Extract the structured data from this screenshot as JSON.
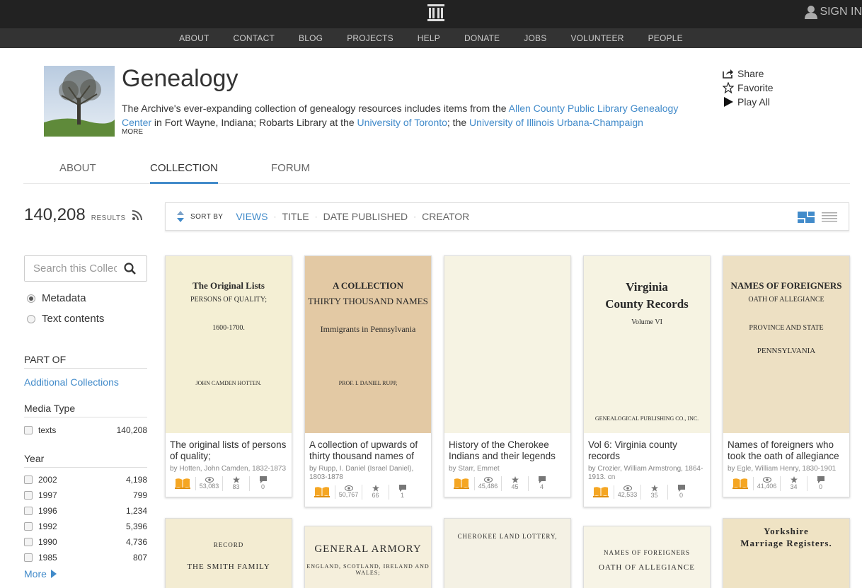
{
  "topbar": {
    "signin": "SIGN IN"
  },
  "nav": [
    "ABOUT",
    "CONTACT",
    "BLOG",
    "PROJECTS",
    "HELP",
    "DONATE",
    "JOBS",
    "VOLUNTEER",
    "PEOPLE"
  ],
  "header": {
    "title": "Genealogy",
    "desc_pre": "The Archive's ever-expanding collection of genealogy resources includes items from the ",
    "link1": "Allen County Public Library Genealogy Center",
    "desc_mid1": " in Fort Wayne, Indiana; Robarts Library at the ",
    "link2": "University of Toronto",
    "desc_mid2": "; the ",
    "link3": "University of Illinois Urbana-Champaign",
    "more": "MORE"
  },
  "actions": {
    "share": "Share",
    "favorite": "Favorite",
    "play_all": "Play All"
  },
  "tabs": [
    "ABOUT",
    "COLLECTION",
    "FORUM"
  ],
  "sidebar": {
    "results_count": "140,208",
    "results_label": "RESULTS",
    "search_placeholder": "Search this Collection",
    "radio_metadata": "Metadata",
    "radio_text": "Text contents",
    "part_of_heading": "PART OF",
    "part_of_link": "Additional Collections",
    "media_type_heading": "Media Type",
    "media_types": [
      {
        "name": "texts",
        "count": "140,208"
      }
    ],
    "year_heading": "Year",
    "years": [
      {
        "name": "2002",
        "count": "4,198"
      },
      {
        "name": "1997",
        "count": "799"
      },
      {
        "name": "1996",
        "count": "1,234"
      },
      {
        "name": "1992",
        "count": "5,396"
      },
      {
        "name": "1990",
        "count": "4,736"
      },
      {
        "name": "1985",
        "count": "807"
      }
    ],
    "more": "More"
  },
  "sortbar": {
    "label": "SORT BY",
    "options": [
      "VIEWS",
      "TITLE",
      "DATE PUBLISHED",
      "CREATOR"
    ]
  },
  "cards": [
    {
      "title": "The original lists of persons of quality;",
      "by": "by Hotten, John Camden, 1832-1873",
      "views": "53,083",
      "favs": "83",
      "reviews": "0",
      "cover": {
        "line1": "The Original Lists",
        "line2": "PERSONS OF QUALITY;",
        "line3": "1600-1700.",
        "line4": "JOHN CAMDEN HOTTEN."
      }
    },
    {
      "title": "A collection of upwards of thirty thousand names of",
      "by": "by Rupp, I. Daniel (Israel Daniel), 1803-1878",
      "views": "50,767",
      "favs": "66",
      "reviews": "1",
      "cover": {
        "line1": "A COLLECTION",
        "line2": "THIRTY THOUSAND NAMES",
        "line3": "Immigrants in Pennsylvania",
        "line4": "PROF. I. DANIEL RUPP,"
      }
    },
    {
      "title": "History of the Cherokee Indians and their legends",
      "by": "by Starr, Emmet",
      "views": "45,486",
      "favs": "45",
      "reviews": "4",
      "cover": {
        "line1": "",
        "line2": "",
        "line3": "",
        "line4": ""
      }
    },
    {
      "title": "Vol 6: Virginia county records",
      "by": "by Crozier, William Armstrong, 1864-1913. cn",
      "views": "42,533",
      "favs": "35",
      "reviews": "0",
      "cover": {
        "line1": "Virginia",
        "line2": "County Records",
        "line3": "Volume VI",
        "line4": "GENEALOGICAL PUBLISHING CO., INC."
      }
    },
    {
      "title": "Names of foreigners who took the oath of allegiance",
      "by": "by Egle, William Henry, 1830-1901",
      "views": "41,406",
      "favs": "34",
      "reviews": "0",
      "cover": {
        "line1": "NAMES OF FOREIGNERS",
        "line2": "OATH OF ALLEGIANCE",
        "line3": "PROVINCE AND STATE",
        "line4": "PENNSYLVANIA"
      }
    }
  ],
  "row2_covers": [
    {
      "line1": "RECORD",
      "line2": "THE SMITH FAMILY"
    },
    {
      "line1": "GENERAL ARMORY",
      "line2": "ENGLAND, SCOTLAND, IRELAND AND WALES;"
    },
    {
      "line1": "CHEROKEE LAND LOTTERY,",
      "line2": ""
    },
    {
      "line1": "NAMES OF FOREIGNERS",
      "line2": "OATH OF ALLEGIANCE"
    },
    {
      "line1": "Yorkshire",
      "line2": "Marriage Registers."
    }
  ],
  "colors": {
    "link": "#428bca",
    "topbar": "#222222",
    "navbar": "#333333",
    "book_icon": "#f5a623"
  }
}
